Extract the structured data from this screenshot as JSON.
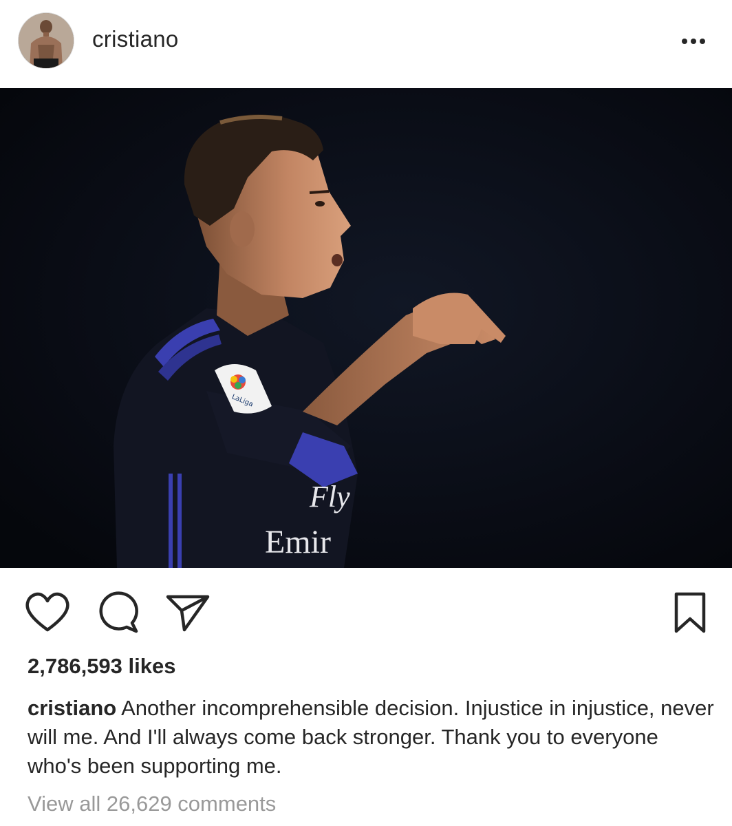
{
  "header": {
    "username": "cristiano",
    "avatar_icon": "profile-avatar",
    "more_icon": "more-options-icon"
  },
  "post": {
    "photo_icon": "post-photo",
    "jersey_text_1": "Fly",
    "jersey_text_2": "Emir",
    "patch_text": "LaLiga"
  },
  "actions": {
    "like_icon": "heart-icon",
    "comment_icon": "comment-icon",
    "share_icon": "share-icon",
    "save_icon": "bookmark-icon"
  },
  "likes": "2,786,593 likes",
  "caption": {
    "user": "cristiano",
    "text": "Another incomprehensible decision. Injustice in injustice, never will me. And I'll always come back stronger. Thank you to everyone who's been supporting me."
  },
  "comments_link": "View all 26,629 comments",
  "colors": {
    "text": "#262626",
    "muted": "#999999",
    "photo_bg": "#0b0e16",
    "jersey_blue": "#3a3fb0"
  }
}
